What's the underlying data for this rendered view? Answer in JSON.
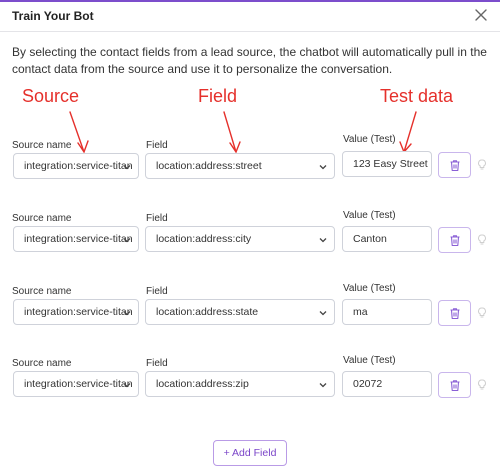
{
  "dialog": {
    "title": "Train Your Bot",
    "description": "By selecting the contact fields from a lead source, the chatbot will automatically pull in the contact data from the source and use it to personalize the conversation."
  },
  "annotations": {
    "source": "Source",
    "field": "Field",
    "test_data": "Test data",
    "color": "#e5302b"
  },
  "labels": {
    "source_name": "Source name",
    "field": "Field",
    "value_test": "Value (Test)"
  },
  "rows": [
    {
      "source": "integration:service-titan",
      "field": "location:address:street",
      "value": "123 Easy Street"
    },
    {
      "source": "integration:service-titan",
      "field": "location:address:city",
      "value": "Canton"
    },
    {
      "source": "integration:service-titan",
      "field": "location:address:state",
      "value": "ma"
    },
    {
      "source": "integration:service-titan",
      "field": "location:address:zip",
      "value": "02072"
    }
  ],
  "add_field_label": "+ Add Field",
  "accent_color": "#7a44c8",
  "icons": {
    "close": "close-icon",
    "delete": "trash-icon",
    "hint": "lightbulb-icon",
    "dropdown": "chevron-down-icon"
  }
}
